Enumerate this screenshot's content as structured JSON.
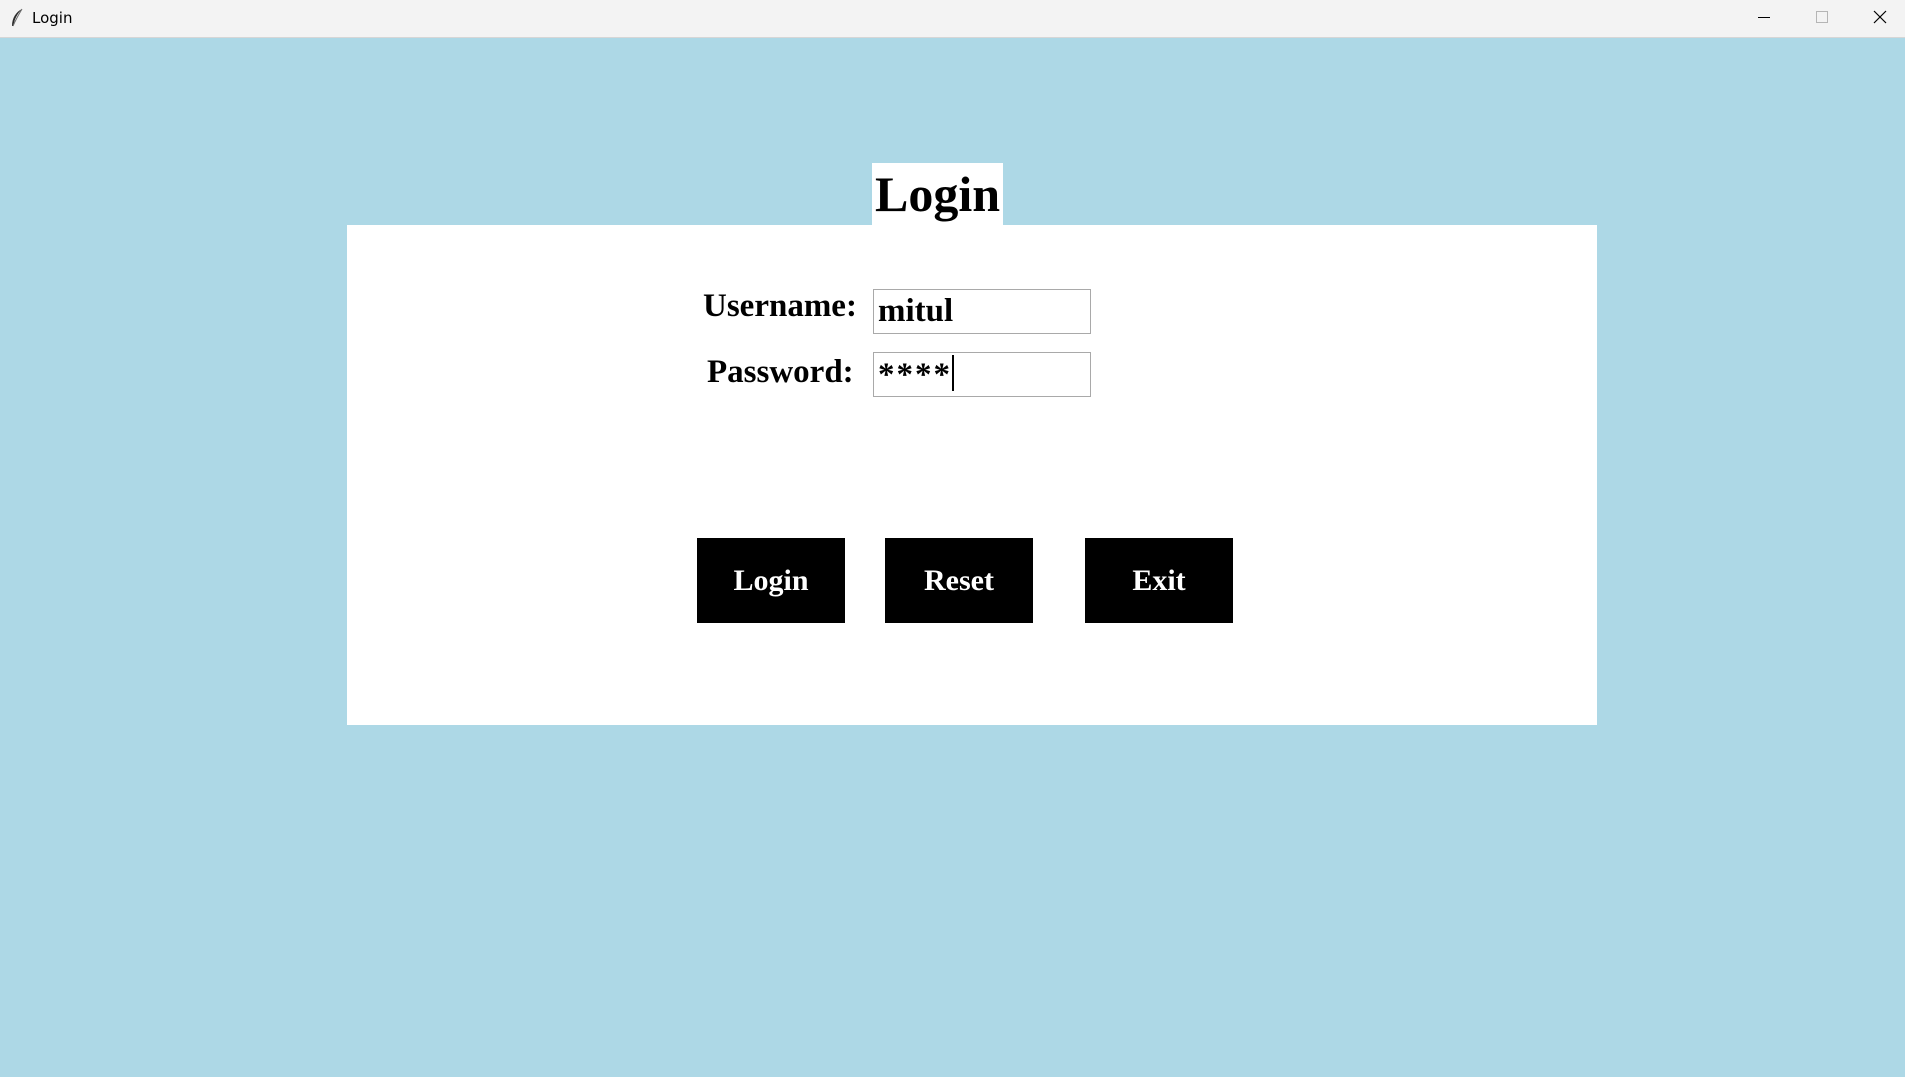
{
  "window": {
    "title": "Login",
    "icon": "feather-icon",
    "controls": [
      "minimize-icon",
      "maximize-icon",
      "close-icon"
    ]
  },
  "heading": "Login",
  "form": {
    "username_label": "Username:",
    "username_value": "mitul",
    "password_label": "Password:",
    "password_value": "****"
  },
  "buttons": {
    "login": "Login",
    "reset": "Reset",
    "exit": "Exit"
  },
  "colors": {
    "background": "#add8e6",
    "panel": "#ffffff",
    "button": "#000000",
    "button_text": "#ffffff"
  }
}
